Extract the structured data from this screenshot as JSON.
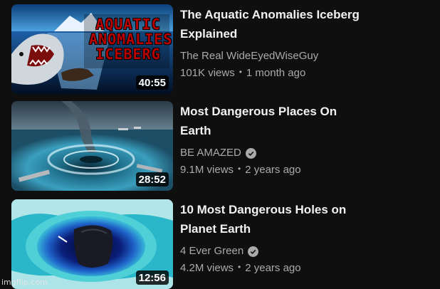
{
  "videos": [
    {
      "thumb_text": [
        "AQUATIC",
        "ANOMALIES",
        "ICEBERG"
      ],
      "duration": "40:55",
      "title_line1": "The Aquatic Anomalies Iceberg",
      "title_line2": "Explained",
      "channel": "The Real WideEyedWiseGuy",
      "verified": false,
      "views": "101K views",
      "age": "1 month ago"
    },
    {
      "duration": "28:52",
      "title_line1": "Most Dangerous Places On",
      "title_line2": "Earth",
      "channel": "BE AMAZED",
      "verified": true,
      "views": "9.1M views",
      "age": "2 years ago"
    },
    {
      "duration": "12:56",
      "title_line1": "10 Most Dangerous Holes on",
      "title_line2": "Planet Earth",
      "channel": "4 Ever Green",
      "verified": true,
      "views": "4.2M views",
      "age": "2 years ago"
    }
  ],
  "separator": "•",
  "watermark": "imgflip.com",
  "colors": {
    "background": "#0f0f0f",
    "title": "#f1f1f1",
    "secondary": "#aaaaaa",
    "thumb_text": "#b80000"
  }
}
